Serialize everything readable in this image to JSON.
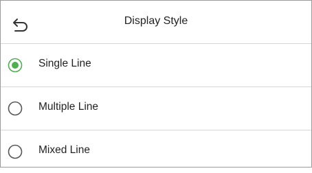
{
  "header": {
    "title": "Display Style"
  },
  "options": [
    {
      "label": "Single Line",
      "selected": true
    },
    {
      "label": "Multiple Line",
      "selected": false
    },
    {
      "label": "Mixed Line",
      "selected": false
    }
  ],
  "colors": {
    "accent": "#4caf50",
    "radio_border": "#555555"
  },
  "icons": {
    "back": "back-arrow-icon",
    "radio_on": "radio-selected-icon",
    "radio_off": "radio-unselected-icon"
  }
}
